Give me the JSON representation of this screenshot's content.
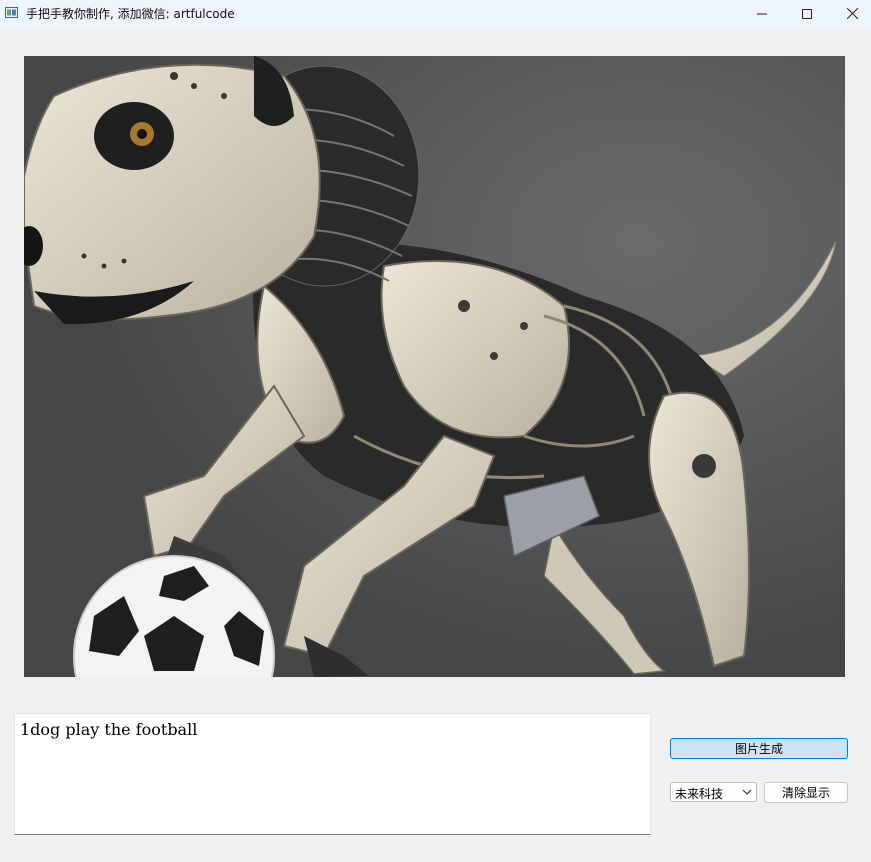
{
  "window": {
    "title": "手把手教你制作, 添加微信: artfulcode",
    "icon": "app-window-icon"
  },
  "controls": {
    "minimize_icon": "minimize-icon",
    "maximize_icon": "maximize-icon",
    "close_icon": "close-icon"
  },
  "image": {
    "subject": "generated-image"
  },
  "prompt": {
    "value": "1dog play the football"
  },
  "buttons": {
    "generate_label": "图片生成",
    "clear_label": "清除显示"
  },
  "model_select": {
    "selected": "未来科技"
  },
  "colors": {
    "accent_border": "#0078d4",
    "accent_fill": "#cce4f7",
    "window_bg": "#f0f0f0"
  }
}
